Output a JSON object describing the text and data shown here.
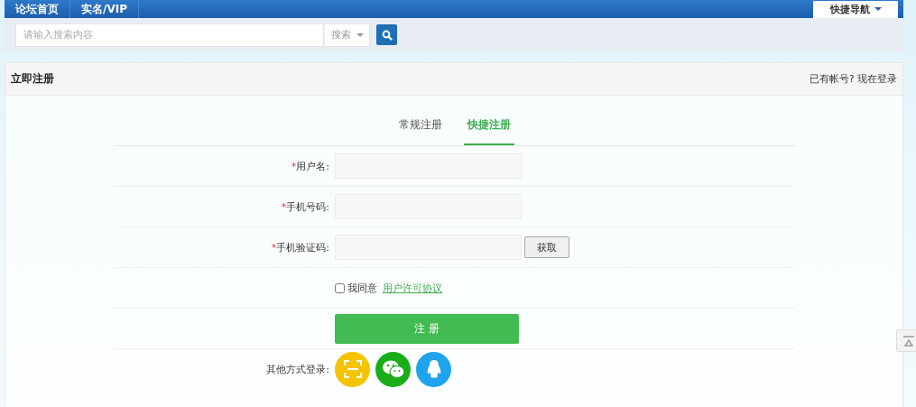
{
  "nav": {
    "items": [
      "论坛首页",
      "实名/VIP"
    ],
    "quick_nav": "快捷导航"
  },
  "search": {
    "placeholder": "请输入搜索内容",
    "type_select": "搜索"
  },
  "panel": {
    "title": "立即注册",
    "login_prompt": "已有帐号? 现在登录"
  },
  "tabs": [
    {
      "label": "常规注册",
      "selected": false
    },
    {
      "label": "快捷注册",
      "selected": true
    }
  ],
  "fields": [
    {
      "required_mark": "*",
      "label": "用户名:",
      "kind": "input"
    },
    {
      "required_mark": "*",
      "label": "手机号码:",
      "kind": "input"
    },
    {
      "required_mark": "*",
      "label": "手机验证码:",
      "kind": "code",
      "button": "获取"
    }
  ],
  "agreement": {
    "text": "我同意",
    "link": "用户许可协议",
    "checked": false
  },
  "submit": "注 册",
  "other_login": {
    "label": "其他方式登录:",
    "methods": [
      {
        "kind": "scan",
        "color": "#f5c400"
      },
      {
        "kind": "wechat",
        "color": "#1aad19"
      },
      {
        "kind": "qq",
        "color": "#1fa3ec"
      }
    ]
  }
}
